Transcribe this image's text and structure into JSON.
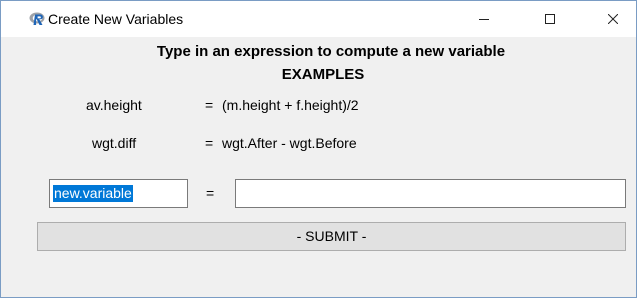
{
  "window": {
    "title": "Create New Variables",
    "icon": "r-logo-icon"
  },
  "heading": {
    "line1": "Type in an expression to compute a new variable",
    "line2": "EXAMPLES"
  },
  "examples": [
    {
      "name": "av.height",
      "eq": "=",
      "expr": "(m.height + f.height)/2"
    },
    {
      "name": "wgt.diff",
      "eq": "=",
      "expr": "wgt.After - wgt.Before"
    }
  ],
  "form": {
    "variable_value": "new.variable",
    "equals": "=",
    "expression_value": "",
    "submit_label": "- SUBMIT -"
  },
  "colors": {
    "selection": "#0078d7",
    "window_bg": "#f0f0f0"
  }
}
